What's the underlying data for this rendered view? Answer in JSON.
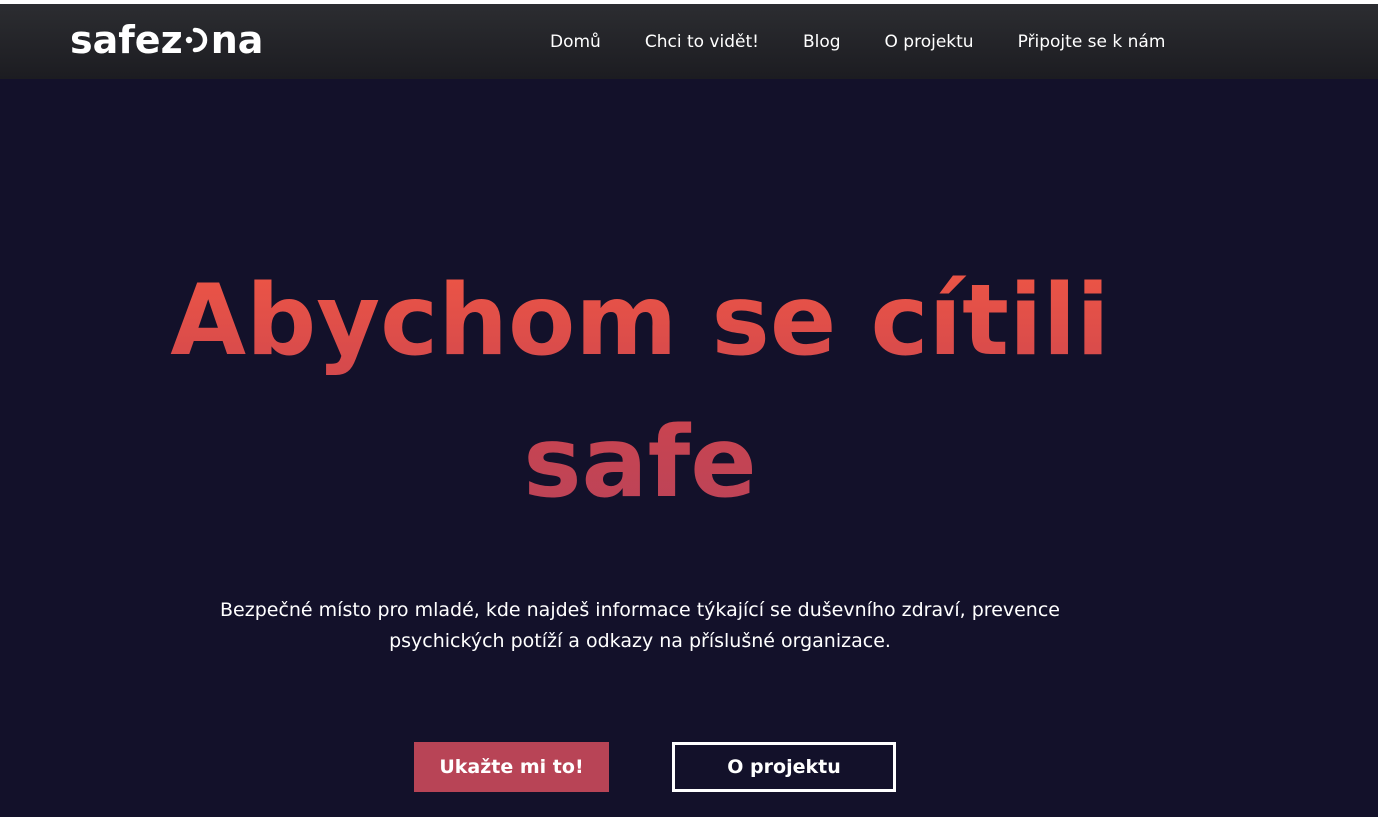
{
  "brand": {
    "logo_prefix": "safez",
    "logo_suffix": "na",
    "logo_mark_icon": "toggle-ring-icon"
  },
  "nav": {
    "items": [
      {
        "label": "Domů"
      },
      {
        "label": "Chci to vidět!"
      },
      {
        "label": "Blog"
      },
      {
        "label": "O projektu"
      },
      {
        "label": "Připojte se k nám"
      }
    ]
  },
  "hero": {
    "title_line1": "Abychom se cítili",
    "title_line2": "safe",
    "subtitle_line1": "Bezpečné místo pro mladé, kde najdeš informace týkající se duševního zdraví, prevence",
    "subtitle_line2": "psychických potíží a odkazy na příslušné organizace.",
    "primary_button": "Ukažte mi to!",
    "secondary_button": "O projektu"
  },
  "colors": {
    "background": "#13112a",
    "accent": "#b84456",
    "title_gradient_start": "#f15744",
    "title_gradient_end": "#b9435a"
  }
}
